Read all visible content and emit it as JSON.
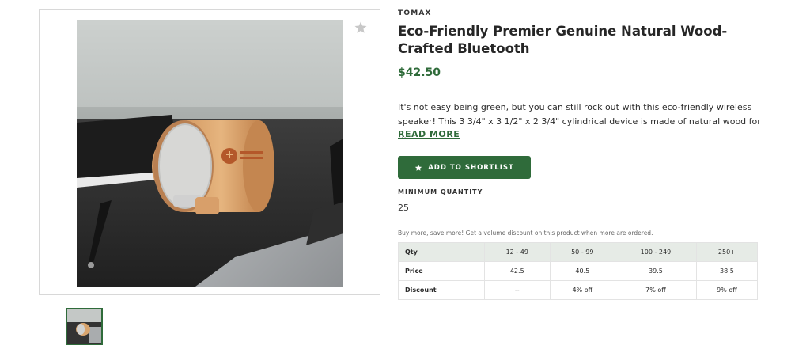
{
  "product": {
    "brand": "TOMAX",
    "title": "Eco-Friendly Premier Genuine Natural Wood-Crafted Bluetooth",
    "price": "$42.50",
    "description": "It's not easy being green, but you can still rock out with this eco-friendly wireless speaker! This 3 3/4\" x 3 1/2\" x 2 3/4\" cylindrical device is made of natural wood for …",
    "read_more": "READ MORE"
  },
  "gallery": {
    "main_image": "speaker-photo",
    "thumbnail_count": 1,
    "favorite_icon": "star-icon"
  },
  "actions": {
    "shortlist_label": "ADD TO SHORTLIST",
    "shortlist_icon": "star-icon"
  },
  "minimum_quantity": {
    "label": "MINIMUM QUANTITY",
    "value": "25"
  },
  "volume_pricing": {
    "note": "Buy more, save more! Get a volume discount on this product when more are ordered.",
    "headers": [
      "Qty",
      "12 - 49",
      "50 - 99",
      "100 - 249",
      "250+"
    ],
    "rows": [
      [
        "Price",
        "42.5",
        "40.5",
        "39.5",
        "38.5"
      ],
      [
        "Discount",
        "--",
        "4% off",
        "7% off",
        "9% off"
      ]
    ]
  },
  "colors": {
    "accent": "#2f6b3a",
    "table_header_bg": "#e6ebe6"
  }
}
